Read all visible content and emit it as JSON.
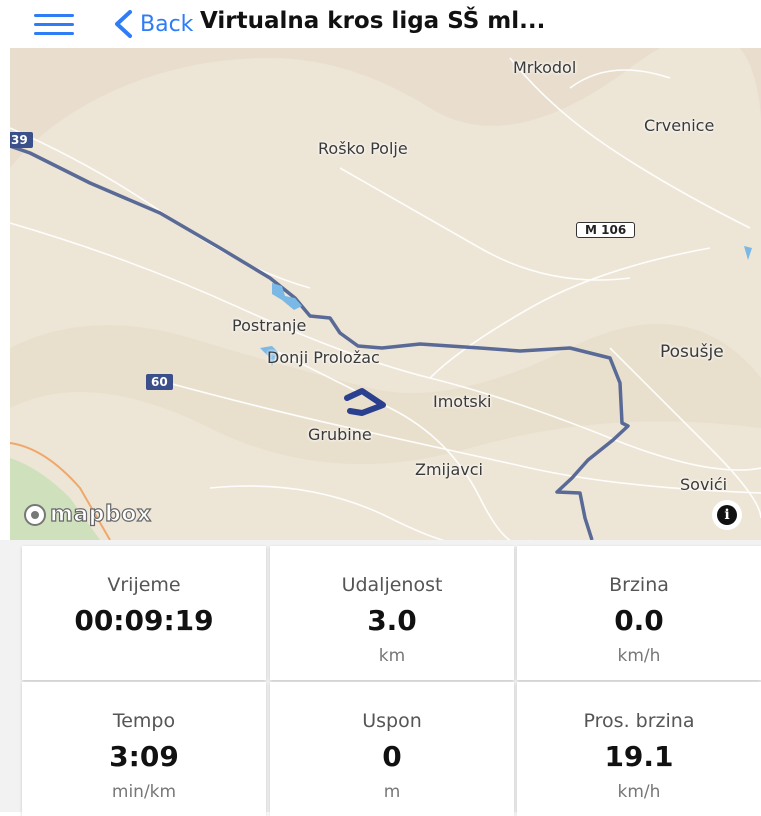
{
  "header": {
    "back_label": "Back",
    "title": "Virtualna kros liga SŠ ml..."
  },
  "map": {
    "places": {
      "mrkodol": "Mrkodol",
      "crvenice": "Crvenice",
      "rosko_polje": "Roško Polje",
      "postranje": "Postranje",
      "donji_prolozac": "Donji Proložac",
      "posusje": "Posušje",
      "imotski": "Imotski",
      "grubine": "Grubine",
      "zmijavci": "Zmijavci",
      "sovici": "Sovići"
    },
    "road_shields": {
      "m106": "M 106",
      "r60": "60",
      "r39": "39"
    },
    "attribution": "mapbox",
    "info": "i",
    "colors": {
      "route": "#5a6a96",
      "track": "#2b3f8f",
      "water": "#7ab8e6",
      "land": "#ede5d6",
      "green": "#cfe0bd"
    }
  },
  "stats": [
    {
      "label": "Vrijeme",
      "value": "00:09:19",
      "unit": ""
    },
    {
      "label": "Udaljenost",
      "value": "3.0",
      "unit": "km"
    },
    {
      "label": "Brzina",
      "value": "0.0",
      "unit": "km/h"
    },
    {
      "label": "Tempo",
      "value": "3:09",
      "unit": "min/km"
    },
    {
      "label": "Uspon",
      "value": "0",
      "unit": "m"
    },
    {
      "label": "Pros. brzina",
      "value": "19.1",
      "unit": "km/h"
    }
  ]
}
